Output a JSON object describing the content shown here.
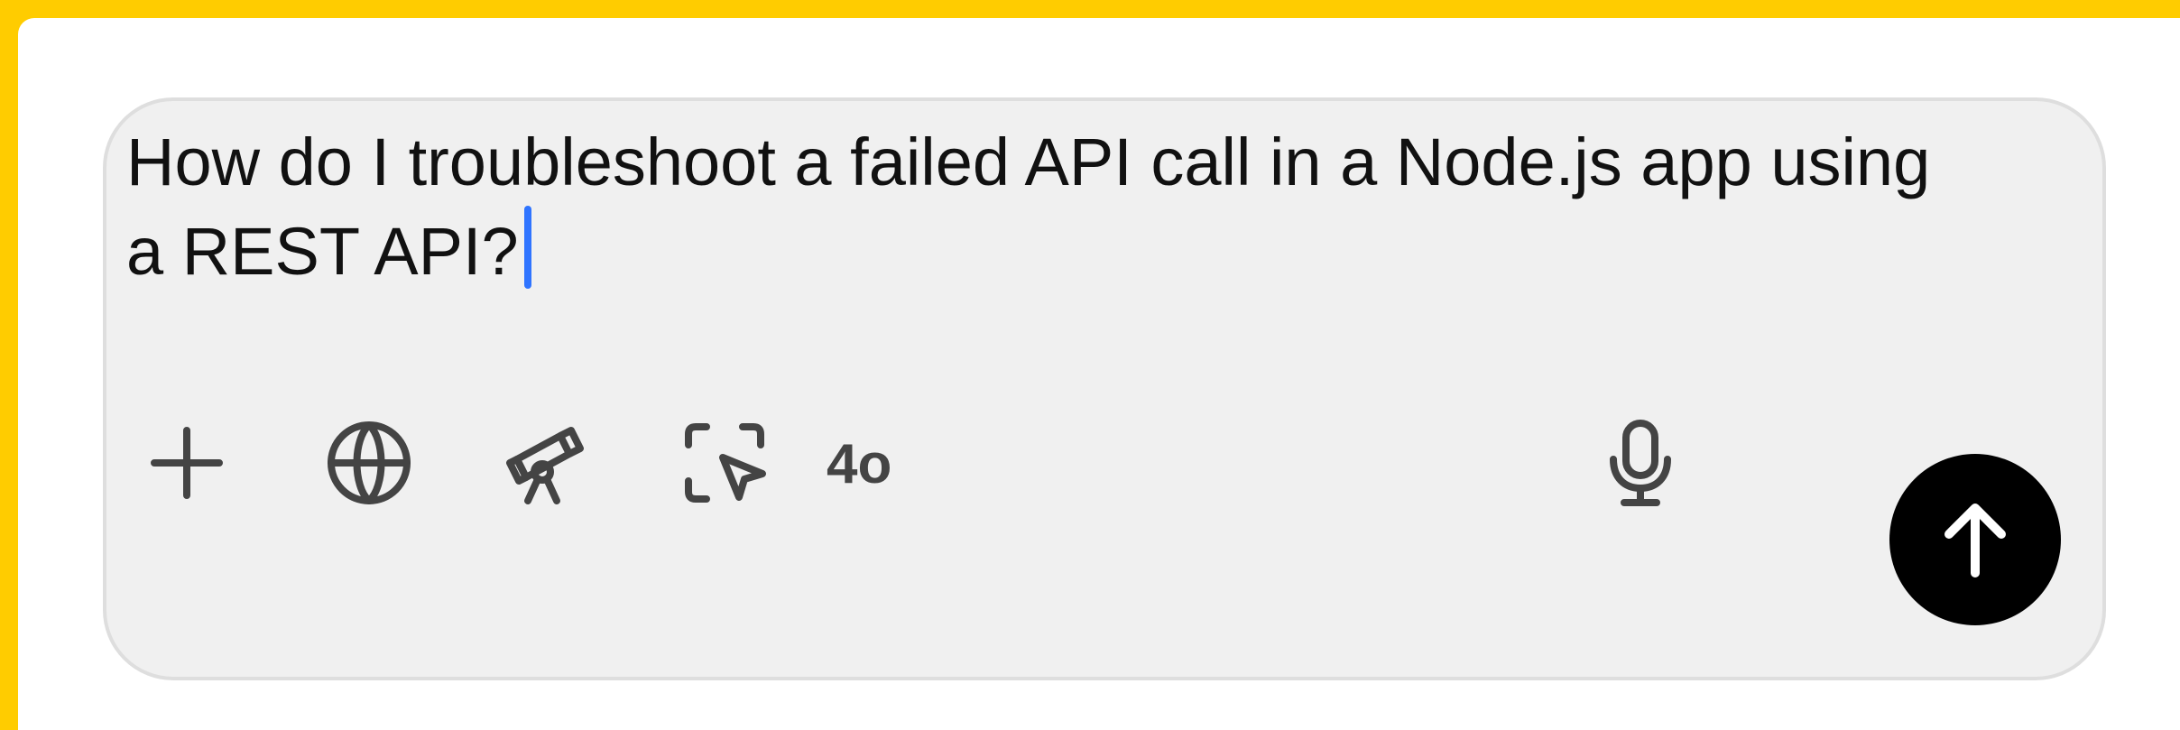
{
  "composer": {
    "prompt_text": "How do I troubleshoot a failed API call in a Node.js app using a REST API?",
    "toolbar": {
      "left_icons": [
        "plus-icon",
        "globe-icon",
        "telescope-icon",
        "cursor-select-icon"
      ],
      "model_label": "4o",
      "right_icons": [
        "microphone-icon",
        "arrow-up-icon"
      ]
    }
  },
  "colors": {
    "page_border": "#ffcc00",
    "composer_background": "#f0f0f0",
    "composer_border": "#dedede",
    "text": "#111111",
    "icon": "#444444",
    "caret": "#2f74ff",
    "send_button": "#000000",
    "send_icon": "#ffffff"
  }
}
